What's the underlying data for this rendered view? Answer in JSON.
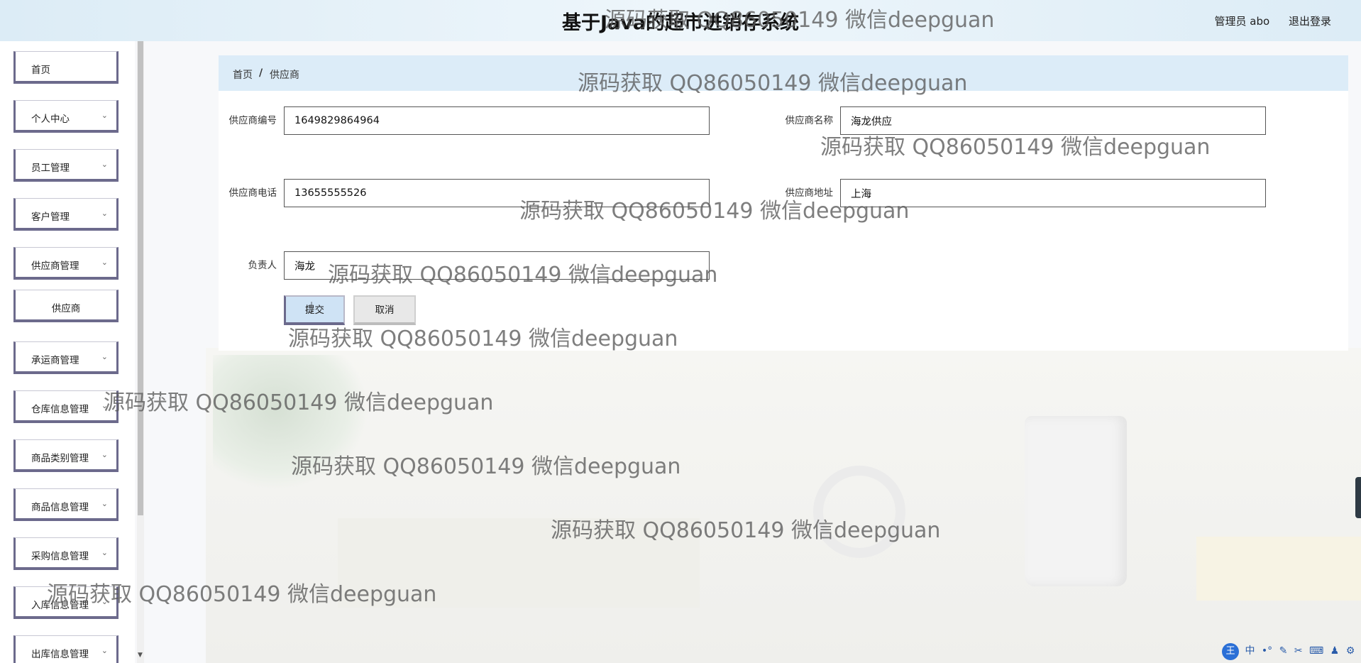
{
  "header": {
    "title": "基于Java的超市进销存系统",
    "user_label": "管理员 abo",
    "logout_label": "退出登录"
  },
  "sidebar": {
    "items": [
      {
        "label": "首页",
        "expandable": false
      },
      {
        "label": "个人中心",
        "expandable": true
      },
      {
        "label": "员工管理",
        "expandable": true
      },
      {
        "label": "客户管理",
        "expandable": true
      },
      {
        "label": "供应商管理",
        "expandable": true
      },
      {
        "label": "供应商",
        "expandable": false,
        "sub": true
      },
      {
        "label": "承运商管理",
        "expandable": true
      },
      {
        "label": "仓库信息管理",
        "expandable": true
      },
      {
        "label": "商品类别管理",
        "expandable": true
      },
      {
        "label": "商品信息管理",
        "expandable": true
      },
      {
        "label": "采购信息管理",
        "expandable": true
      },
      {
        "label": "入库信息管理",
        "expandable": true
      },
      {
        "label": "出库信息管理",
        "expandable": true
      }
    ]
  },
  "breadcrumb": {
    "home": "首页",
    "separator": "/",
    "current": "供应商"
  },
  "form": {
    "supplier_no_label": "供应商编号",
    "supplier_no_value": "1649829864964",
    "supplier_name_label": "供应商名称",
    "supplier_name_value": "海龙供应",
    "supplier_phone_label": "供应商电话",
    "supplier_phone_value": "13655555526",
    "supplier_addr_label": "供应商地址",
    "supplier_addr_value": "上海",
    "manager_label": "负责人",
    "manager_value": "海龙",
    "submit_label": "提交",
    "cancel_label": "取消"
  },
  "watermark": "源码获取 QQ86050149 微信deepguan",
  "ime_toolbar": {
    "logo": "王",
    "lang": "中"
  },
  "colors": {
    "header_bg": "#dcecf6",
    "breadcrumb_bg": "#dcecf8",
    "menu_border": "#6c6a8c",
    "submit_bg": "#cfe3f5"
  }
}
